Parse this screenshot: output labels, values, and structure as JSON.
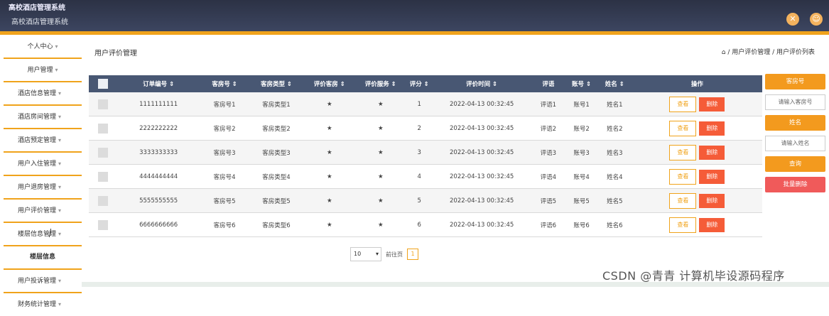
{
  "app": {
    "title": "高校酒店管理系统",
    "subtitle": "高校酒店管理系统",
    "close_icon": "close-icon",
    "user_icon": "user-icon"
  },
  "sidebar": {
    "items": [
      {
        "label": "个人中心"
      },
      {
        "label": "用户管理"
      },
      {
        "label": "酒店信息管理"
      },
      {
        "label": "酒店房间管理"
      },
      {
        "label": "酒店预定管理"
      },
      {
        "label": "用户入住管理"
      },
      {
        "label": "用户退房管理"
      },
      {
        "label": "用户评价管理"
      },
      {
        "label": "楼层信息管理"
      }
    ],
    "subitem": "楼层信息",
    "items_after": [
      {
        "label": "用户投诉管理"
      },
      {
        "label": "财务统计管理"
      }
    ]
  },
  "page": {
    "title": "用户评价管理",
    "breadcrumb": "/ 用户评价管理 / 用户评价列表"
  },
  "table": {
    "headers": [
      "订单编号",
      "客房号",
      "客房类型",
      "评价客房",
      "评价服务",
      "评分",
      "评价时间",
      "评语",
      "账号",
      "姓名",
      "操作"
    ],
    "rows": [
      {
        "order": "1111111111",
        "room": "客房号1",
        "type": "客房类型1",
        "rate_room": "★",
        "rate_service": "★",
        "score": "1",
        "time": "2022-04-13 00:32:45",
        "comment": "评语1",
        "account": "账号1",
        "name": "姓名1"
      },
      {
        "order": "2222222222",
        "room": "客房号2",
        "type": "客房类型2",
        "rate_room": "★",
        "rate_service": "★",
        "score": "2",
        "time": "2022-04-13 00:32:45",
        "comment": "评语2",
        "account": "账号2",
        "name": "姓名2"
      },
      {
        "order": "3333333333",
        "room": "客房号3",
        "type": "客房类型3",
        "rate_room": "★",
        "rate_service": "★",
        "score": "3",
        "time": "2022-04-13 00:32:45",
        "comment": "评语3",
        "account": "账号3",
        "name": "姓名3"
      },
      {
        "order": "4444444444",
        "room": "客房号4",
        "type": "客房类型4",
        "rate_room": "★",
        "rate_service": "★",
        "score": "4",
        "time": "2022-04-13 00:32:45",
        "comment": "评语4",
        "account": "账号4",
        "name": "姓名4"
      },
      {
        "order": "5555555555",
        "room": "客房号5",
        "type": "客房类型5",
        "rate_room": "★",
        "rate_service": "★",
        "score": "5",
        "time": "2022-04-13 00:32:45",
        "comment": "评语5",
        "account": "账号5",
        "name": "姓名5"
      },
      {
        "order": "6666666666",
        "room": "客房号6",
        "type": "客房类型6",
        "rate_room": "★",
        "rate_service": "★",
        "score": "6",
        "time": "2022-04-13 00:32:45",
        "comment": "评语6",
        "account": "账号6",
        "name": "姓名6"
      }
    ],
    "view_label": "查看",
    "delete_label": "删除"
  },
  "right_panel": {
    "room_label": "客房号",
    "room_placeholder": "请输入客房号",
    "name_label": "姓名",
    "name_placeholder": "请输入姓名",
    "search_label": "查询",
    "batch_delete_label": "批量删除"
  },
  "pager": {
    "page_size": "10",
    "goto_label": "前往页",
    "current_page": "1"
  },
  "watermark": "CSDN @青青  计算机毕设源码程序",
  "colors": {
    "accent": "#f0a31b",
    "header": "#485773",
    "danger": "#f55c38",
    "topbar": "#2c3245"
  }
}
